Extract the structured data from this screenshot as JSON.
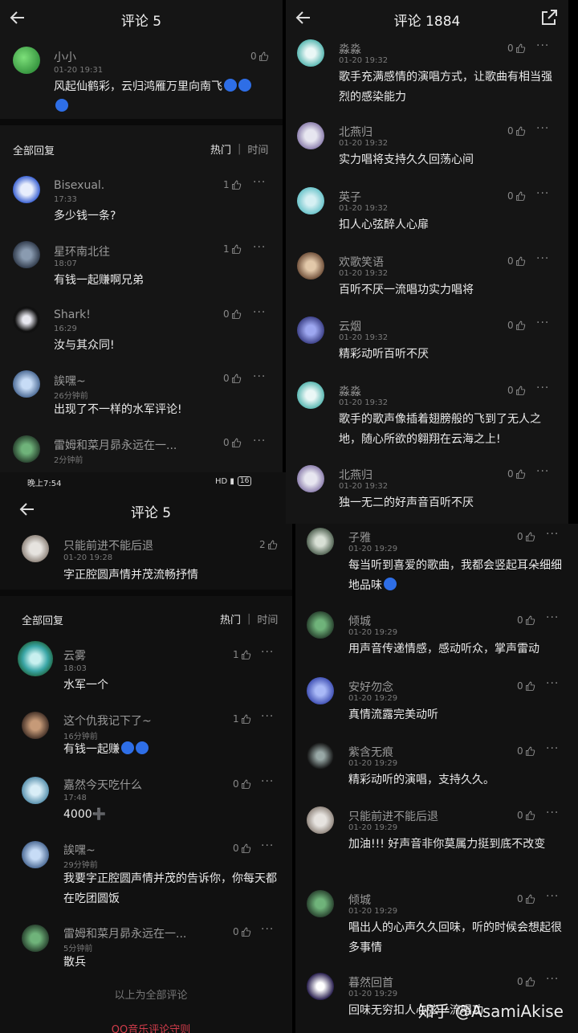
{
  "panel_a": {
    "title": "评论 5",
    "main": {
      "name": "小小",
      "time": "01-20 19:31",
      "likes": "0",
      "text": "风起仙鹤彩，云归鸿雁万里向南飞"
    },
    "header": {
      "all": "全部回复",
      "hot": "热门",
      "sep": "|",
      "time": "时间"
    },
    "replies": [
      {
        "name": "Bisexual.",
        "time": "17:33",
        "likes": "1",
        "text": "多少钱一条?"
      },
      {
        "name": "星环南北往",
        "time": "18:07",
        "likes": "1",
        "text": "有钱一起赚啊兄弟"
      },
      {
        "name": "Shark!",
        "time": "16:29",
        "likes": "0",
        "text": "汝与其众同!"
      },
      {
        "name": "誒嘿~",
        "time": "26分钟前",
        "likes": "0",
        "text": "出现了不一样的水军评论!"
      },
      {
        "name": "雷姆和菜月昴永远在一...",
        "time": "2分钟前",
        "likes": "0",
        "text": ""
      }
    ]
  },
  "status_bar": {
    "time": "晚上7:54",
    "battery": "16"
  },
  "panel_b": {
    "title": "评论 5",
    "main": {
      "name": "只能前进不能后退",
      "time": "01-20 19:28",
      "likes": "2",
      "text": "字正腔圆声情并茂流畅抒情"
    },
    "header": {
      "all": "全部回复",
      "hot": "热门",
      "sep": "|",
      "time": "时间"
    },
    "replies": [
      {
        "name": "云雾",
        "time": "18:03",
        "likes": "1",
        "text": "水军一个"
      },
      {
        "name": "这个仇我记下了~",
        "time": "16分钟前",
        "likes": "1",
        "text": "有钱一起赚"
      },
      {
        "name": "嘉然今天吃什么",
        "time": "17:48",
        "likes": "0",
        "text": "4000➕"
      },
      {
        "name": "誒嘿~",
        "time": "29分钟前",
        "likes": "0",
        "text": "我要字正腔圆声情并茂的告诉你，你每天都在吃团圆饭"
      },
      {
        "name": "雷姆和菜月昴永远在一...",
        "time": "5分钟前",
        "likes": "0",
        "text": "散兵"
      }
    ],
    "footer_note": "以上为全部评论",
    "footer_link": "QQ音乐评论守则"
  },
  "panel_c": {
    "title": "评论 1884",
    "comments": [
      {
        "name": "淼淼",
        "time": "01-20 19:32",
        "likes": "0",
        "text": "歌手充满感情的演唱方式，让歌曲有相当强烈的感染能力"
      },
      {
        "name": "北燕归",
        "time": "01-20 19:32",
        "likes": "0",
        "text": "实力唱将支持久久回荡心间"
      },
      {
        "name": "英子",
        "time": "01-20 19:32",
        "likes": "0",
        "text": "扣人心弦醉人心扉"
      },
      {
        "name": "欢歌笑语",
        "time": "01-20 19:32",
        "likes": "0",
        "text": "百听不厌一流唱功实力唱将"
      },
      {
        "name": "云烟",
        "time": "01-20 19:32",
        "likes": "0",
        "text": "精彩动听百听不厌"
      },
      {
        "name": "淼淼",
        "time": "01-20 19:32",
        "likes": "0",
        "text": "歌手的歌声像插着翅膀般的飞到了无人之地，随心所欲的翱翔在云海之上!"
      },
      {
        "name": "北燕归",
        "time": "01-20 19:32",
        "likes": "0",
        "text": "独一无二的好声音百听不厌"
      }
    ]
  },
  "panel_d": {
    "comments": [
      {
        "name": "子雅",
        "time": "01-20 19:29",
        "likes": "0",
        "text": "每当听到喜爱的歌曲，我都会竖起耳朵细细地品味"
      },
      {
        "name": "倾城",
        "time": "01-20 19:29",
        "likes": "0",
        "text": "用声音传递情感，感动听众，掌声雷动"
      },
      {
        "name": "安好勿念",
        "time": "01-20 19:29",
        "likes": "0",
        "text": "真情流露完美动听"
      },
      {
        "name": "紫含无痕",
        "time": "01-20 19:29",
        "likes": "0",
        "text": "精彩动听的演唱，支持久久。"
      },
      {
        "name": "只能前进不能后退",
        "time": "01-20 19:29",
        "likes": "0",
        "text": "加油!!! 好声音非你莫属力挺到底不改变"
      },
      {
        "name": "倾城",
        "time": "01-20 19:29",
        "likes": "0",
        "text": "唱出人的心声久久回味，听的时候会想起很多事情"
      },
      {
        "name": "暮然回首",
        "time": "01-20 19:29",
        "likes": "0",
        "text": "回味无穷扣人心弦一流唱功"
      }
    ]
  },
  "watermark": "知乎 @AsamiAkise"
}
